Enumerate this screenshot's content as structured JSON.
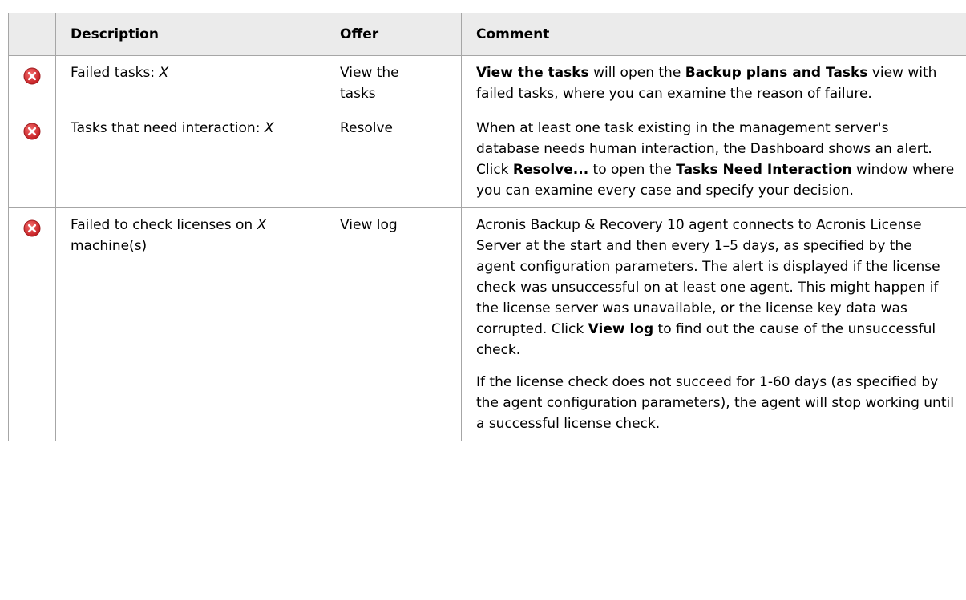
{
  "header": {
    "description": "Description",
    "offer": "Offer",
    "comment": "Comment"
  },
  "rows": [
    {
      "icon": "error-icon",
      "desc_text": "Failed tasks: ",
      "desc_var": "X",
      "offer": "View the tasks",
      "comment": {
        "b1": "View the tasks",
        "t1": " will open the ",
        "b2": "Backup plans and Tasks",
        "t2": " view with failed tasks, where you can examine the reason of failure."
      }
    },
    {
      "icon": "error-icon",
      "desc_text": "Tasks that need interaction: ",
      "desc_var": "X",
      "offer": "Resolve",
      "comment": {
        "t1": "When at least one task existing in the management server's database needs human interaction, the Dashboard shows an alert. Click ",
        "b1": "Resolve...",
        "t2": " to open the ",
        "b2": "Tasks Need Interaction",
        "t3": " window where you can examine every case and specify your decision."
      }
    },
    {
      "icon": "error-icon",
      "desc_text": "Failed to check licenses on ",
      "desc_var": "X",
      "desc_tail": " machine(s)",
      "offer": "View log",
      "comment": {
        "t1": "Acronis Backup & Recovery 10 agent connects to Acronis License Server at the start and then every 1–5 days, as specified by the agent configuration parameters. The alert is displayed if the license check was unsuccessful on at least one agent. This might happen if the license server was unavailable, or the license key data was corrupted. Click ",
        "b1": "View log",
        "t2": " to find out the cause of the unsuccessful check.",
        "p2": "If the license check does not succeed for 1-60 days (as specified by the agent configuration parameters), the agent will stop working until a successful license check."
      }
    }
  ],
  "colors": {
    "header_bg": "#ebebeb",
    "border": "#a6a6a6",
    "error_red": "#d8282b"
  }
}
